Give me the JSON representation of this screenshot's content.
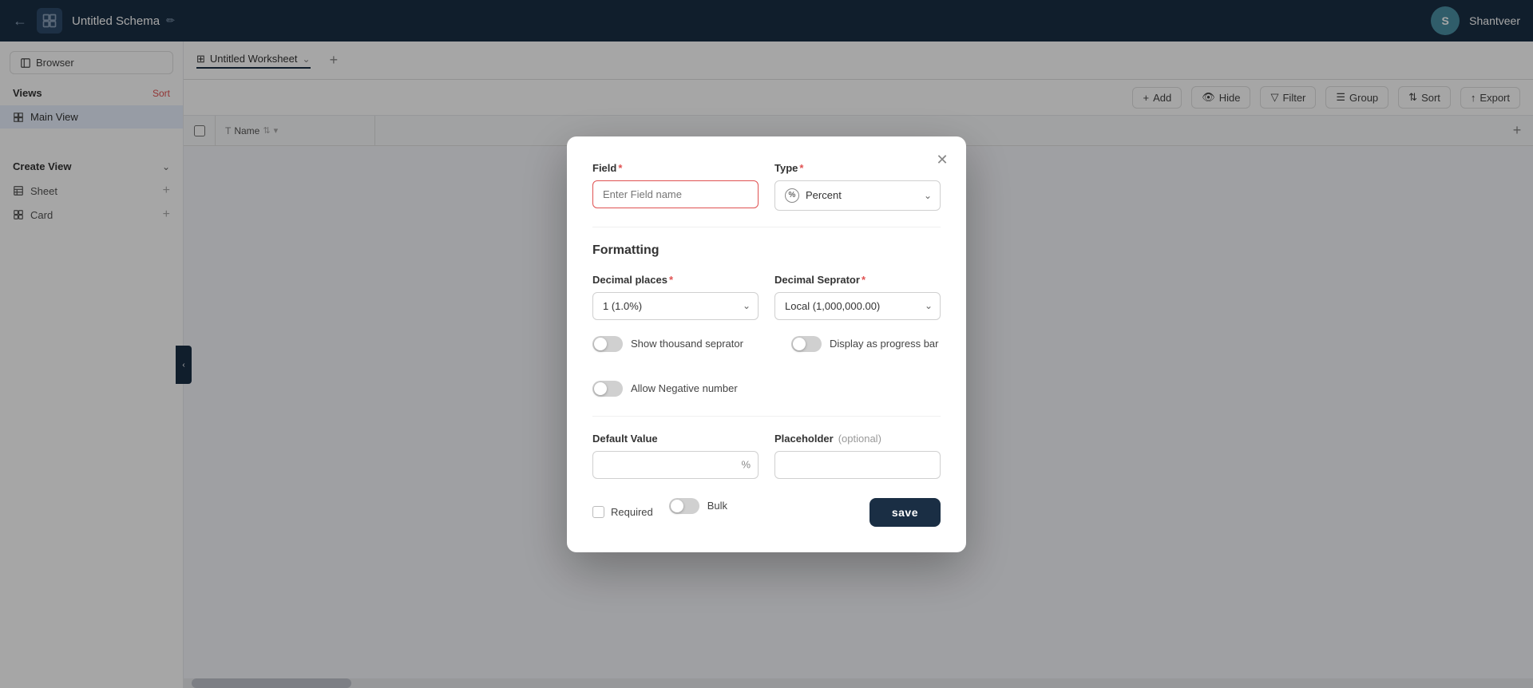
{
  "topbar": {
    "title": "Untitled Schema",
    "edit_icon": "✏",
    "avatar_initials": "S",
    "username": "Shantveer"
  },
  "worksheet": {
    "tab_label": "Untitled Worksheet",
    "tab_icon": "⊞"
  },
  "toolbar": {
    "add_label": "Add",
    "hide_label": "Hide",
    "filter_label": "Filter",
    "group_label": "Group",
    "sort_label": "Sort",
    "export_label": "Export"
  },
  "sidebar": {
    "browser_label": "Browser",
    "views_label": "Views",
    "sort_label": "Sort",
    "main_view_label": "Main View",
    "create_view_label": "Create View",
    "sheet_label": "Sheet",
    "card_label": "Card"
  },
  "table": {
    "name_col_label": "Name"
  },
  "modal": {
    "close_icon": "✕",
    "field_label": "Field",
    "type_label": "Type",
    "field_placeholder": "Enter Field name",
    "type_value": "Percent",
    "formatting_title": "Formatting",
    "decimal_places_label": "Decimal places",
    "decimal_separator_label": "Decimal Seprator",
    "decimal_places_value": "1 (1.0%)",
    "decimal_separator_value": "Local (1,000,000.00)",
    "show_thousand_sep_label": "Show thousand seprator",
    "display_progress_label": "Display as progress bar",
    "allow_negative_label": "Allow Negative number",
    "default_value_label": "Default Value",
    "placeholder_label": "Placeholder",
    "optional_label": "(optional)",
    "percent_suffix": "%",
    "required_label": "Required",
    "bulk_label": "Bulk",
    "save_label": "save"
  }
}
